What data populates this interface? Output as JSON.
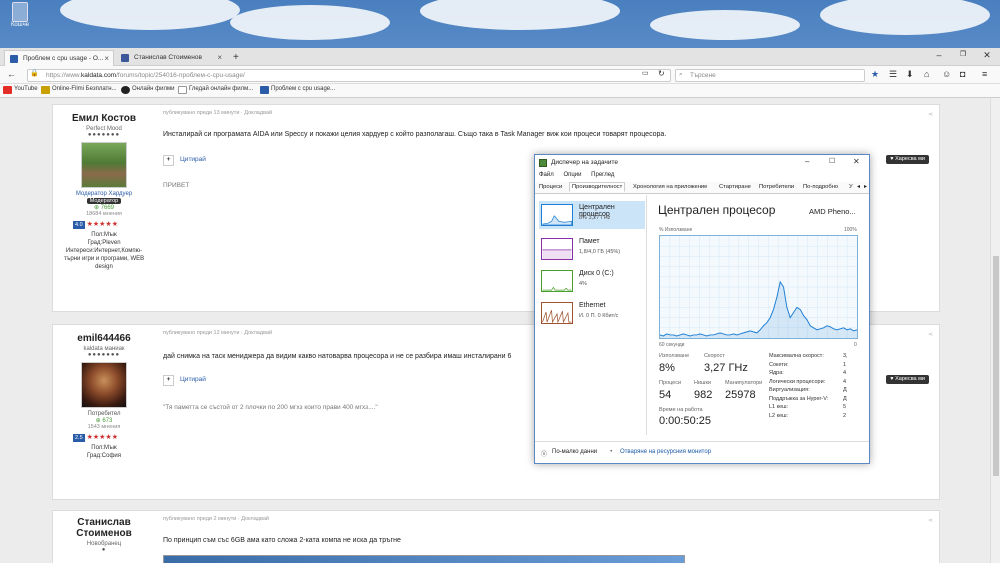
{
  "desktop": {
    "recycle_label": "Кошче"
  },
  "browser": {
    "tabs": [
      {
        "label": "Проблем с cpu usage - О..."
      },
      {
        "label": "Станислав Стоименов"
      }
    ],
    "url_prefix": "https://www.",
    "url_domain": "kaldata.com",
    "url_path": "/forums/topic/254016-проблем-с-cpu-usage/",
    "search_placeholder": "Търсене",
    "bookmarks": [
      {
        "label": "YouTube",
        "color": "#e52d27"
      },
      {
        "label": "Online-Filmi Безплатн...",
        "color": "#c8a000"
      },
      {
        "label": "Онлайн филми",
        "color": "#222"
      },
      {
        "label": "Гледай онлайн филм...",
        "color": "#444"
      },
      {
        "label": "Проблем с cpu usage...",
        "color": "#2a5ca8"
      }
    ]
  },
  "posts": [
    {
      "author": "Емил Костов",
      "role": "Perfect Mood",
      "dots": "●●●●●●●",
      "mod_label": "Модератор Хардуер",
      "badge": "Модератор",
      "rep": "7669",
      "posts_count": "18684 мнения",
      "rating": "4.0",
      "stars": "★★★★★",
      "info": [
        "Пол:Мъж",
        "Град:Pleven",
        "Интереси:Интернет,Компю-",
        "търни игри и програми, WEB",
        "design"
      ],
      "time": "публикувано преди 13 минути · Докладвай",
      "text": "Инсталирай си програмата AIDA или Speccy и покажи целия хардуер с който разполагаш. Също така в Task Manager виж кои процеси товарят процесора.",
      "cite": "Цитирай",
      "like": "Харесва ми",
      "sig": "ПРИВЕТ"
    },
    {
      "author": "emil644466",
      "role": "kaldata маниак",
      "dots": "●●●●●●●",
      "mod_label": "Потребител",
      "rep": "673",
      "posts_count": "1543 мнения",
      "rating": "2.5",
      "stars": "★★★★★",
      "info": [
        "Пол:Мъж",
        "Град:София"
      ],
      "time": "публикувано преди 12 минути · Докладвай",
      "text": "дай снимка на таск мениджера да видим какво натоварва процесора и не се разбира имаш инсталирани 6",
      "cite": "Цитирай",
      "like": "Харесва ми",
      "sig": "\"Тя паметта се състой от 2 плочки по 200 мгхз които прави 400 мгхз....\""
    },
    {
      "author_line1": "Станислав",
      "author_line2": "Стоименов",
      "role": "Новобранец",
      "time": "публикувано преди 2 минути · Докладвай",
      "text": "По принцип съм със 6GB ама като сложа 2-ката компа не иска да тръгне"
    }
  ],
  "task_manager": {
    "title": "Диспечер на задачите",
    "menu": [
      "Файл",
      "Опции",
      "Преглед"
    ],
    "tabs": [
      "Процеси",
      "Производителност",
      "Хронология на приложение",
      "Стартиране",
      "Потребители",
      "По-подробно",
      "У"
    ],
    "resources": [
      {
        "name": "Централен процесор",
        "value": "8% 3,27 ГHz",
        "color": "#1f7fd4"
      },
      {
        "name": "Памет",
        "value": "1,8/4,0 ГБ (45%)",
        "color": "#8b2fa8"
      },
      {
        "name": "Диск 0 (C:)",
        "value": "4%",
        "color": "#4aa02c"
      },
      {
        "name": "Ethernet",
        "value": "И. 0 П. 0 Кбит/с",
        "color": "#a0522d"
      }
    ],
    "main_title": "Централен процесор",
    "processor": "AMD Pheno...",
    "usage_label": "% Използване",
    "max_label": "100%",
    "time_label": "60 секунди",
    "zero_label": "0",
    "cpu_history": [
      3,
      2,
      4,
      3,
      3,
      2,
      3,
      4,
      3,
      2,
      3,
      3,
      4,
      3,
      2,
      3,
      3,
      4,
      5,
      4,
      3,
      3,
      4,
      3,
      4,
      5,
      6,
      7,
      6,
      5,
      8,
      12,
      15,
      20,
      28,
      40,
      55,
      50,
      30,
      20,
      25,
      30,
      28,
      22,
      18,
      12,
      10,
      8,
      9,
      10,
      12,
      11,
      9,
      8,
      9,
      10,
      8,
      9,
      7,
      8
    ],
    "stats": {
      "usage_label": "Използване",
      "usage": "8%",
      "speed_label": "Скорост",
      "speed": "3,27 ГHz",
      "processes_label": "Процеси",
      "processes": "54",
      "threads_label": "Нишки",
      "threads": "982",
      "handles_label": "Манипулатори",
      "handles": "25978",
      "uptime_label": "Време на работа",
      "uptime": "0:00:50:25"
    },
    "specs": [
      {
        "k": "Максимална скорост:",
        "v": "3,"
      },
      {
        "k": "Сокети:",
        "v": "1"
      },
      {
        "k": "Ядра:",
        "v": "4"
      },
      {
        "k": "Логически процесори:",
        "v": "4"
      },
      {
        "k": "Виртуализация:",
        "v": "Д"
      },
      {
        "k": "Поддръжка за Hyper-V:",
        "v": "Д"
      },
      {
        "k": "L1 кеш:",
        "v": "5"
      },
      {
        "k": "L2 кеш:",
        "v": "2"
      }
    ],
    "less_details": "По-малко данни",
    "resource_monitor": "Отваряне на ресурсния монитор"
  }
}
